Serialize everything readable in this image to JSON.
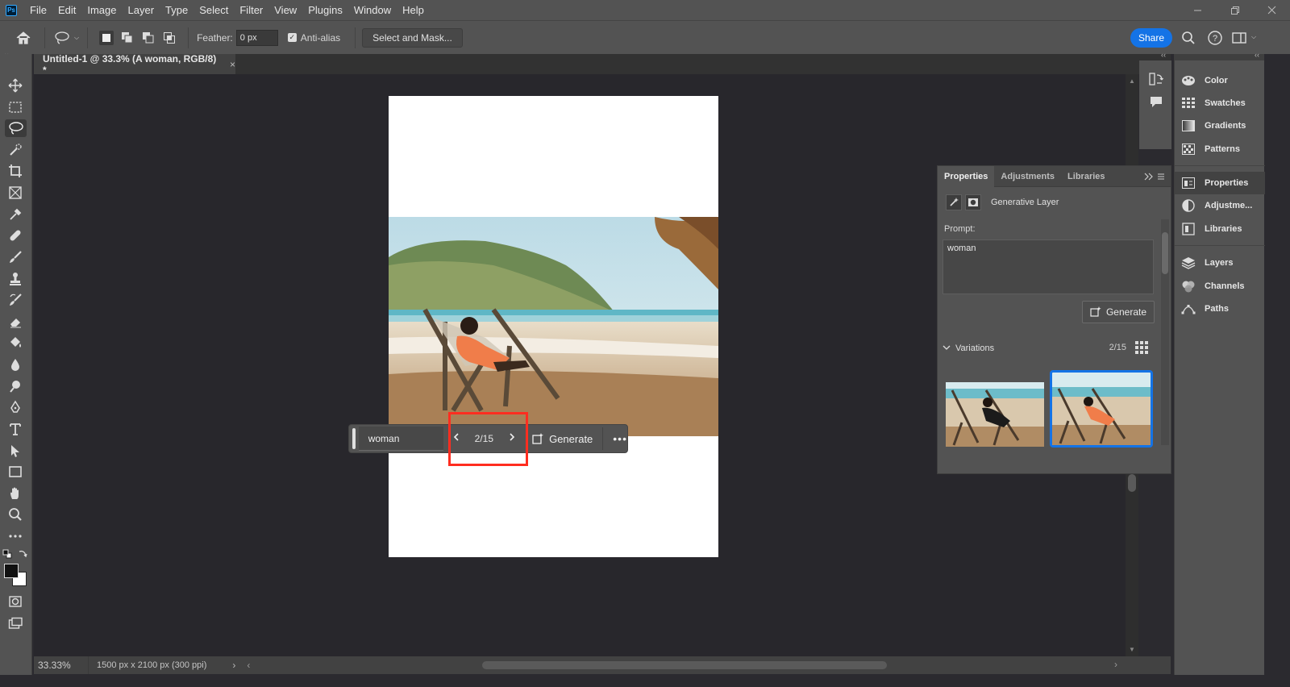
{
  "menu": {
    "logo": "Ps",
    "items": [
      "File",
      "Edit",
      "Image",
      "Layer",
      "Type",
      "Select",
      "Filter",
      "View",
      "Plugins",
      "Window",
      "Help"
    ]
  },
  "window_controls": [
    "minimize-icon",
    "restore-icon",
    "close-icon"
  ],
  "options_bar": {
    "feather_label": "Feather:",
    "feather_value": "0 px",
    "antialias_label": "Anti-alias",
    "antialias_checked": true,
    "select_mask_label": "Select and Mask...",
    "share_label": "Share"
  },
  "document_tab": {
    "title": "Untitled-1 @ 33.3% (A woman, RGB/8) *",
    "close": "×"
  },
  "contextual_bar": {
    "prompt": "woman",
    "counter": "2/15",
    "generate_label": "Generate",
    "more": "•••"
  },
  "status_bar": {
    "zoom": "33.33%",
    "doc_info": "1500 px x 2100 px (300 ppi)",
    "arrow": "›"
  },
  "properties_panel": {
    "tabs": [
      "Properties",
      "Adjustments",
      "Libraries"
    ],
    "active_tab": "Properties",
    "layer_type": "Generative Layer",
    "prompt_label": "Prompt:",
    "prompt_value": "woman",
    "generate_label": "Generate",
    "variations_label": "Variations",
    "variations_count": "2/15",
    "selected_variation": 2
  },
  "dock": {
    "items": [
      "Color",
      "Swatches",
      "Gradients",
      "Patterns",
      "Properties",
      "Adjustme...",
      "Libraries",
      "Layers",
      "Channels",
      "Paths"
    ],
    "active": "Properties"
  },
  "colors": {
    "accent": "#1473e6",
    "highlight": "#ff2d20",
    "ui_bg": "#535353",
    "canvas_bg": "#28272c"
  }
}
